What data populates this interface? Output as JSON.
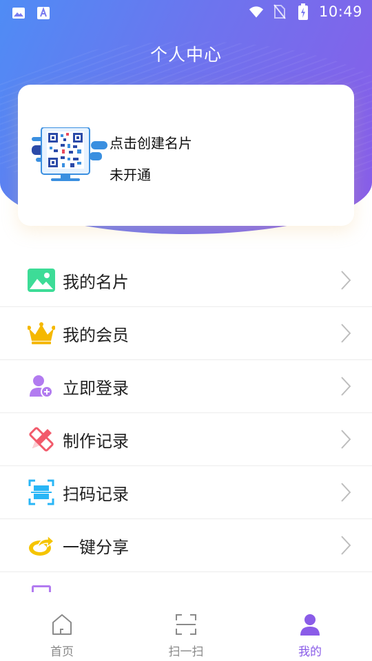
{
  "status_bar": {
    "time": "10:49",
    "left_icons": [
      "image-icon",
      "font-a-icon"
    ],
    "right_icons": [
      "wifi-icon",
      "no-sim-icon",
      "battery-charging-icon"
    ]
  },
  "header": {
    "title": "个人中心"
  },
  "profile_card": {
    "title": "点击创建名片",
    "status": "未开通",
    "illustration": "qr-code-card-icon"
  },
  "menu": {
    "items": [
      {
        "label": "我的名片",
        "icon": "image-card-icon",
        "color": "#3ddc97"
      },
      {
        "label": "我的会员",
        "icon": "crown-icon",
        "color": "#f5b800"
      },
      {
        "label": "立即登录",
        "icon": "user-add-icon",
        "color": "#b27bf0"
      },
      {
        "label": "制作记录",
        "icon": "pencil-ruler-icon",
        "color": "#f25a6b"
      },
      {
        "label": "扫码记录",
        "icon": "scan-icon",
        "color": "#29b6f6"
      },
      {
        "label": "一键分享",
        "icon": "share-icon",
        "color": "#f5c400"
      }
    ]
  },
  "bottom_nav": {
    "items": [
      {
        "label": "首页",
        "icon": "home-icon",
        "active": false
      },
      {
        "label": "扫一扫",
        "icon": "scan-frame-icon",
        "active": false
      },
      {
        "label": "我的",
        "icon": "person-icon",
        "active": true
      }
    ],
    "active_color": "#8a5ce8",
    "inactive_color": "#888888"
  }
}
